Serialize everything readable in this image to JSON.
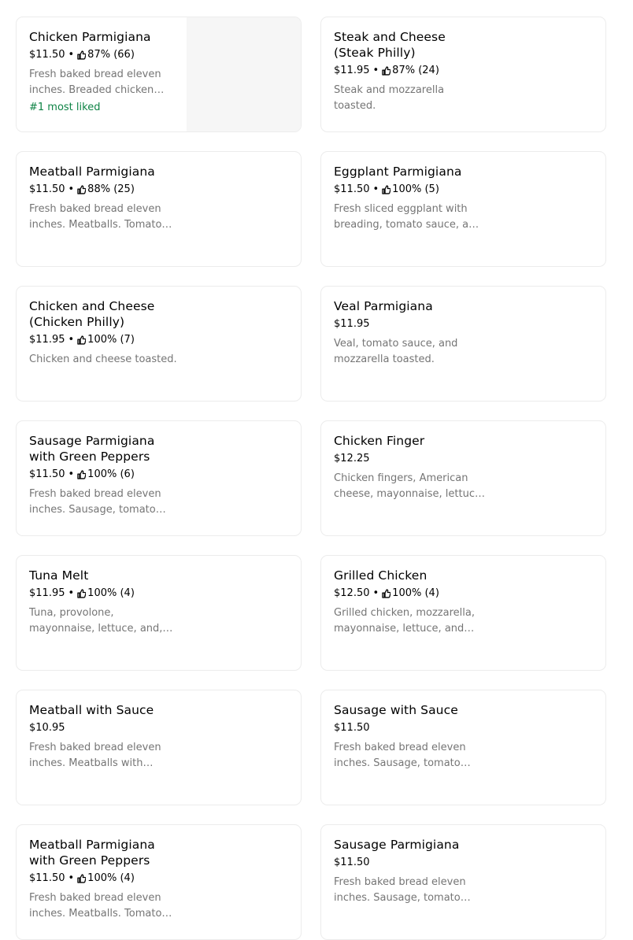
{
  "menu_items": [
    {
      "name": "Chicken Parmigiana",
      "price": "$11.50",
      "rating": "87% (66)",
      "description": "Fresh baked bread eleven inches. Breaded chicken cutlet, tomato sauce, and mozzarella toasted.",
      "badge": "#1 most liked",
      "has_image": true
    },
    {
      "name": "Steak and Cheese (Steak Philly)",
      "price": "$11.95",
      "rating": "87% (24)",
      "description": "Steak and mozzarella toasted."
    },
    {
      "name": "Meatball Parmigiana",
      "price": "$11.50",
      "rating": "88% (25)",
      "description": "Fresh baked bread eleven inches. Meatballs. Tomato sauce, and mozzarella toasted."
    },
    {
      "name": "Eggplant Parmigiana",
      "price": "$11.50",
      "rating": "100% (5)",
      "description": "Fresh sliced eggplant with breading, tomato sauce, and mozzarella toasted."
    },
    {
      "name": "Chicken and Cheese (Chicken Philly)",
      "price": "$11.95",
      "rating": "100% (7)",
      "description": "Chicken and cheese toasted."
    },
    {
      "name": "Veal Parmigiana",
      "price": "$11.95",
      "description": "Veal, tomato sauce, and mozzarella toasted."
    },
    {
      "name": "Sausage Parmigiana with Green Peppers",
      "price": "$11.50",
      "rating": "100% (6)",
      "description": "Fresh baked bread eleven inches. Sausage, tomato sauce, green peppers, and mozzarella toasted."
    },
    {
      "name": "Chicken Finger",
      "price": "$12.25",
      "description": "Chicken fingers, American cheese, mayonnaise, lettuce, and tomato."
    },
    {
      "name": "Tuna Melt",
      "price": "$11.95",
      "rating": "100% (4)",
      "description": "Tuna, provolone, mayonnaise, lettuce, and, tomato toasted."
    },
    {
      "name": "Grilled Chicken",
      "price": "$12.50",
      "rating": "100% (4)",
      "description": "Grilled chicken, mozzarella, mayonnaise, lettuce, and tomato toasted."
    },
    {
      "name": "Meatball with Sauce",
      "price": "$10.95",
      "description": "Fresh baked bread eleven inches. Meatballs with tomato sauce toasted."
    },
    {
      "name": "Sausage with Sauce",
      "price": "$11.50",
      "description": "Fresh baked bread eleven inches. Sausage, tomato sauce toasted."
    },
    {
      "name": "Meatball Parmigiana with Green Peppers",
      "price": "$11.50",
      "rating": "100% (4)",
      "description": "Fresh baked bread eleven inches. Meatballs. Tomato sauce, green peppers, and mozzarella toasted."
    },
    {
      "name": "Sausage Parmigiana",
      "price": "$11.50",
      "description": "Fresh baked bread eleven inches. Sausage, tomato sauce, and mozzarella toasted."
    }
  ],
  "colors": {
    "badge_green": "#0e8345",
    "description_gray": "#757575",
    "card_border": "#ececec",
    "image_placeholder": "#f6f6f6"
  },
  "icons": {
    "rating": "thumbs-up-icon"
  }
}
